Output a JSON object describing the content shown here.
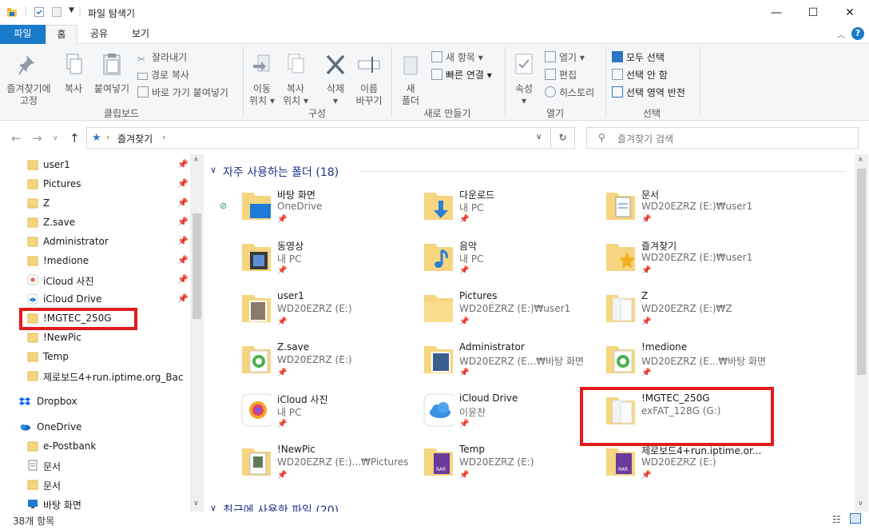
{
  "window": {
    "title": "파일 탐색기",
    "minimize": "—",
    "maximize": "☐",
    "close": "✕"
  },
  "ribbon_tabs": [
    {
      "label": "파일"
    },
    {
      "label": "홈"
    },
    {
      "label": "공유"
    },
    {
      "label": "보기"
    }
  ],
  "ribbon": {
    "clipboard": {
      "pin_label_1": "즐겨찾기에",
      "pin_label_2": "고정",
      "copy": "복사",
      "paste": "붙여넣기",
      "cut": "잘라내기",
      "copy_path": "경로 복사",
      "paste_shortcut": "바로 가기 붙여넣기",
      "group": "클립보드"
    },
    "organize": {
      "move_1": "이동",
      "move_2": "위치",
      "copyto_1": "복사",
      "copyto_2": "위치",
      "delete": "삭제",
      "rename_1": "이름",
      "rename_2": "바꾸기",
      "group": "구성"
    },
    "new": {
      "new_folder_1": "새",
      "new_folder_2": "폴더",
      "new_item": "새 항목",
      "easy_access": "빠른 연결",
      "group": "새로 만들기"
    },
    "open": {
      "properties": "속성",
      "open": "열기",
      "edit": "편집",
      "history": "히스토리",
      "group": "열기"
    },
    "select": {
      "select_all": "모두 선택",
      "select_none": "선택 안 함",
      "invert": "선택 영역 반전",
      "group": "선택"
    }
  },
  "address": {
    "crumb": "즐겨찾기",
    "search_placeholder": "즐겨찾기 검색"
  },
  "nav_pane": {
    "items": [
      {
        "label": "user1",
        "pinned": true
      },
      {
        "label": "Pictures",
        "pinned": true
      },
      {
        "label": "Z",
        "pinned": true
      },
      {
        "label": "Z.save",
        "pinned": true
      },
      {
        "label": "Administrator",
        "pinned": true
      },
      {
        "label": "!medione",
        "pinned": true
      },
      {
        "label": "iCloud 사진",
        "pinned": true
      },
      {
        "label": "iCloud Drive",
        "pinned": true
      },
      {
        "label": "!MGTEC_250G",
        "pinned": false
      },
      {
        "label": "!NewPic",
        "pinned": false
      },
      {
        "label": "Temp",
        "pinned": false
      },
      {
        "label": "제로보드4+run.iptime.org_Bac",
        "pinned": false
      },
      {
        "label": "Dropbox",
        "pinned": false
      },
      {
        "label": "OneDrive",
        "pinned": false
      },
      {
        "label": "e-Postbank",
        "pinned": false
      },
      {
        "label": "문서",
        "pinned": false
      },
      {
        "label": "문서",
        "pinned": false
      },
      {
        "label": "바탕 화면",
        "pinned": false
      }
    ]
  },
  "content": {
    "section_title": "자주 사용하는 폴더 (18)",
    "section_next": "최근에 사용한 파일 (20)",
    "folders": [
      {
        "name": "바탕 화면",
        "sub": "OneDrive"
      },
      {
        "name": "다운로드",
        "sub": "내 PC"
      },
      {
        "name": "문서",
        "sub": "WD20EZRZ (E:)₩user1"
      },
      {
        "name": "동영상",
        "sub": "내 PC"
      },
      {
        "name": "음악",
        "sub": "내 PC"
      },
      {
        "name": "즐겨찾기",
        "sub": "WD20EZRZ (E:)₩user1"
      },
      {
        "name": "user1",
        "sub": "WD20EZRZ (E:)"
      },
      {
        "name": "Pictures",
        "sub": "WD20EZRZ (E:)₩user1"
      },
      {
        "name": "Z",
        "sub": "WD20EZRZ (E:)₩Z"
      },
      {
        "name": "Z.save",
        "sub": "WD20EZRZ (E:)"
      },
      {
        "name": "Administrator",
        "sub": "WD20EZRZ (E...₩바탕 화면"
      },
      {
        "name": "!medione",
        "sub": "WD20EZRZ (E...₩바탕 화면"
      },
      {
        "name": "iCloud 사진",
        "sub": "내 PC"
      },
      {
        "name": "iCloud Drive",
        "sub": "이윤찬"
      },
      {
        "name": "!MGTEC_250G",
        "sub": "exFAT_128G (G:)"
      },
      {
        "name": "!NewPic",
        "sub": "WD20EZRZ (E:)...₩Pictures"
      },
      {
        "name": "Temp",
        "sub": "WD20EZRZ (E:)"
      },
      {
        "name": "제로보드4+run.iptime.or...",
        "sub": "WD20EZRZ (E:)"
      }
    ]
  },
  "status": {
    "count": "38개 항목"
  },
  "colors": {
    "accent": "#1979ca",
    "highlight_box": "#e21b1b",
    "folder": "#f6d580"
  }
}
